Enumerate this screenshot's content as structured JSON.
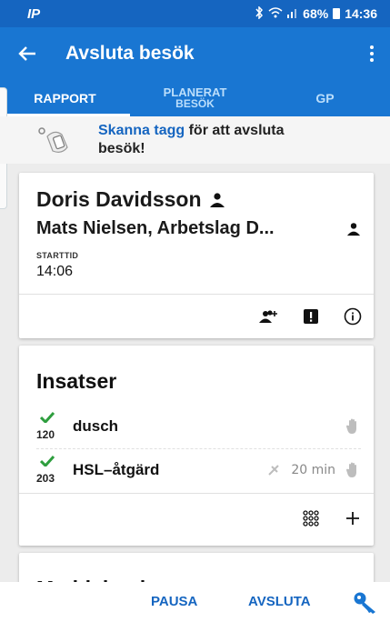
{
  "status_bar": {
    "carrier": "IP",
    "battery": "68%",
    "time": "14:36"
  },
  "app_bar": {
    "title": "Avsluta besök",
    "back_icon": "arrow-left-icon",
    "menu_icon": "more-vert-icon"
  },
  "tabs": [
    {
      "label": "RAPPORT",
      "active": true
    },
    {
      "label": "PLANERAT",
      "label2": "BESÖK",
      "active": false
    },
    {
      "label": "GP",
      "active": false
    }
  ],
  "scan_banner": {
    "link_text": "Skanna tagg",
    "text": "för att avsluta",
    "text2": "besök!"
  },
  "visit_card": {
    "client_name": "Doris Davidsson",
    "staff": "Mats Nielsen, Arbetslag D...",
    "start_label": "STARTTID",
    "start_time": "14:06"
  },
  "insatser": {
    "title": "Insatser",
    "items": [
      {
        "code": "120",
        "name": "dusch",
        "duration": ""
      },
      {
        "code": "203",
        "name": "HSL–åtgärd",
        "duration": "20 min"
      }
    ]
  },
  "messages": {
    "title": "Meddelanden"
  },
  "bottom_bar": {
    "pause": "PAUSA",
    "finish": "AVSLUTA"
  },
  "colors": {
    "primary": "#1976d2",
    "accent": "#1565c0",
    "check": "#2e9e3e"
  }
}
